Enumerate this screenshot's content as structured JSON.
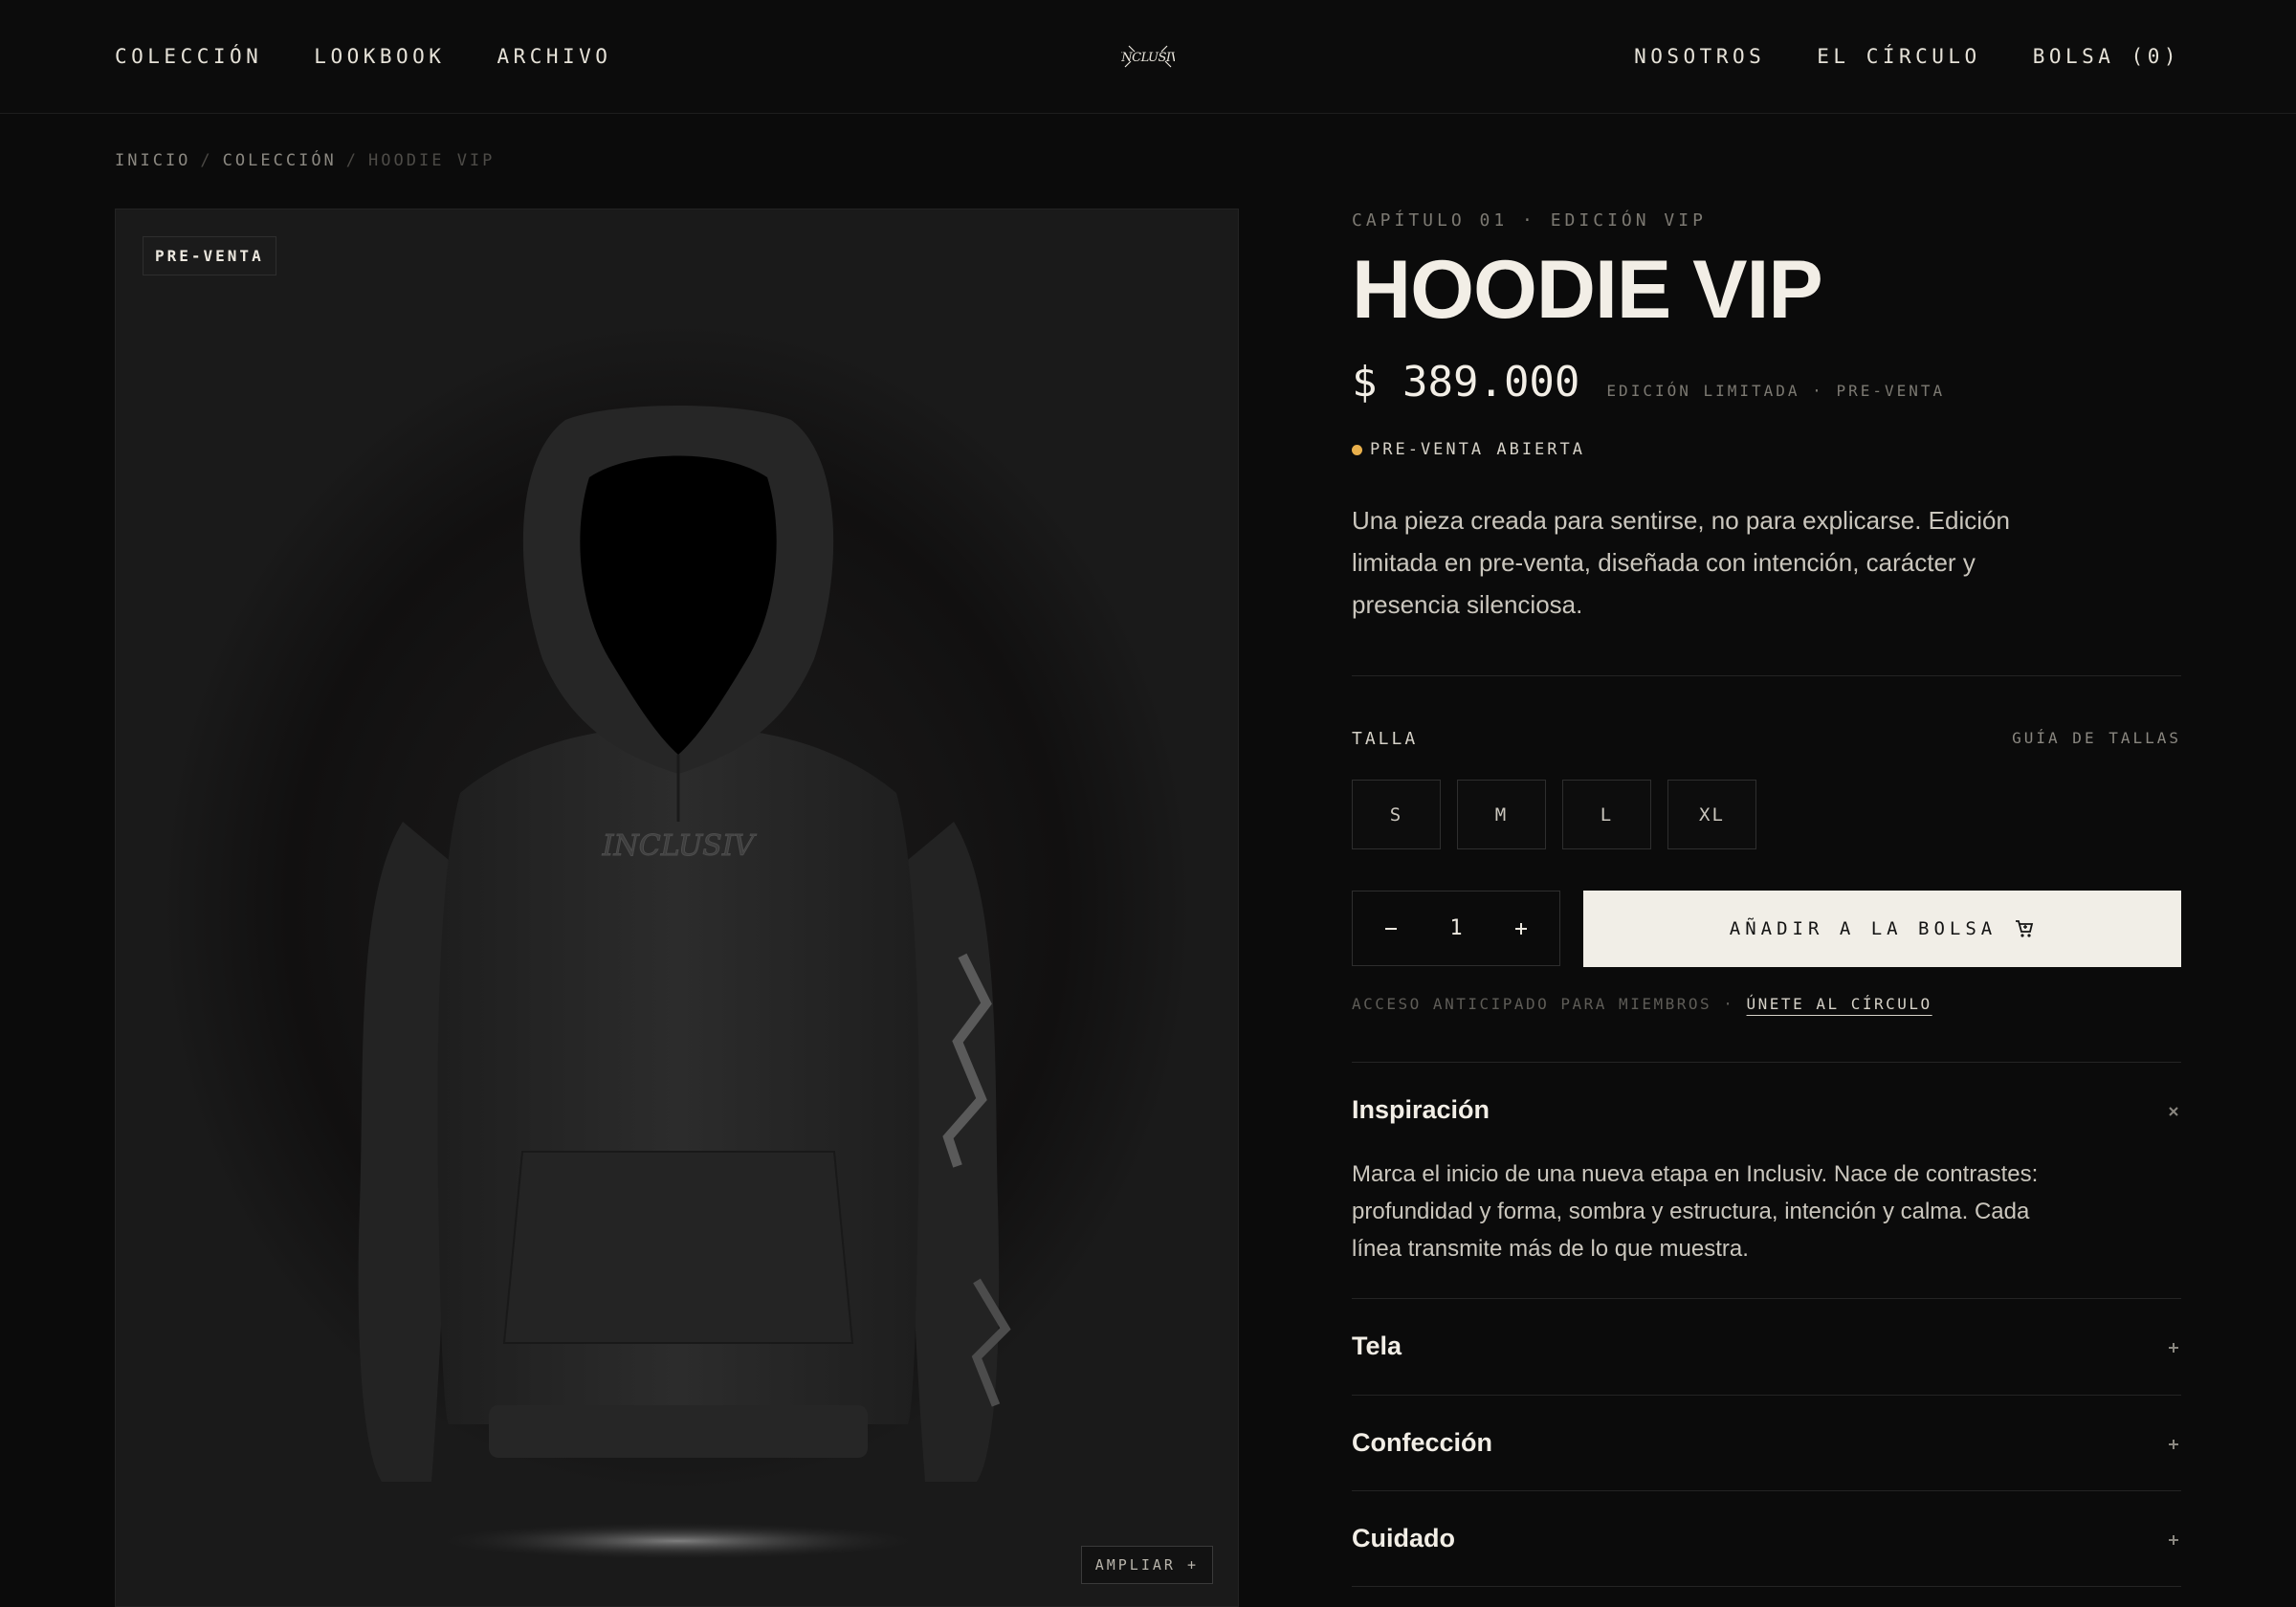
{
  "header": {
    "nav_left": [
      "COLECCIÓN",
      "LOOKBOOK",
      "ARCHIVO"
    ],
    "nav_right": [
      "NOSOTROS",
      "EL CÍRCULO",
      "BOLSA (0)"
    ],
    "logo_text": "INCLUSIV"
  },
  "breadcrumb": {
    "items": [
      "INICIO",
      "COLECCIÓN",
      "HOODIE VIP"
    ],
    "separator": "/"
  },
  "image": {
    "badge": "PRE-VENTA",
    "zoom_label": "AMPLIAR +"
  },
  "product": {
    "kicker": "CAPÍTULO 01 · EDICIÓN VIP",
    "title": "HOODIE VIP",
    "price": "$ 389.000",
    "price_note": "EDICIÓN LIMITADA · PRE-VENTA",
    "status": "PRE-VENTA ABIERTA",
    "status_color": "#e9b04c",
    "description": "Una pieza creada para sentirse, no para explicarse. Edición limitada en pre-venta, diseñada con intención, carácter y presencia silenciosa."
  },
  "size": {
    "label": "TALLA",
    "guide": "GUÍA DE TALLAS",
    "options": [
      "S",
      "M",
      "L",
      "XL"
    ]
  },
  "cart": {
    "quantity": "1",
    "add_label": "AÑADIR A LA BOLSA",
    "member_note": "ACCESO ANTICIPADO PARA MIEMBROS ·",
    "join_label": "ÚNETE AL CÍRCULO"
  },
  "accordion": [
    {
      "title": "Inspiración",
      "icon": "close-icon",
      "body": "Marca el inicio de una nueva etapa en Inclusiv. Nace de contrastes: profundidad y forma, sombra y estructura, intención y calma. Cada línea transmite más de lo que muestra."
    },
    {
      "title": "Tela",
      "icon": "plus-icon"
    },
    {
      "title": "Confección",
      "icon": "plus-icon"
    },
    {
      "title": "Cuidado",
      "icon": "plus-icon"
    }
  ],
  "colors": {
    "background": "#0b0b0b",
    "accent_button": "#f1eee7"
  }
}
